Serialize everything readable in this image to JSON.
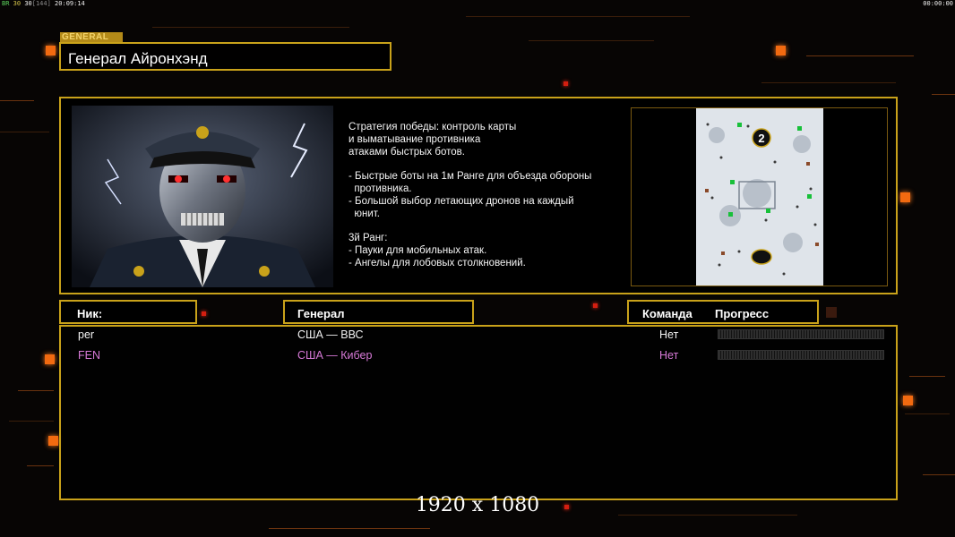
{
  "hud": {
    "left_green": "ВR",
    "left_yellow": "30",
    "left_white": "30",
    "left_gray": "[144]",
    "left_time": "20:09:14",
    "right_time": "00:00:00"
  },
  "general": {
    "category": "GENERAL",
    "name": "Генерал Айронхэнд"
  },
  "description": {
    "lines_a": [
      "Стратегия победы: контроль карты",
      "и выматывание противника",
      "атаками быстрых ботов."
    ],
    "lines_b": [
      "- Быстрые боты на 1м Ранге для объезда обороны",
      "  противника.",
      "- Большой выбор летающих дронов на каждый",
      "  юнит."
    ],
    "lines_c": [
      "3й Ранг:",
      "- Пауки для мобильных атак.",
      "- Ангелы для лобовых столкновений."
    ]
  },
  "map": {
    "player_marker": "2"
  },
  "columns": {
    "nick": "Ник:",
    "general": "Генерал",
    "team": "Команда",
    "progress": "Прогресс"
  },
  "players": [
    {
      "nick": "per",
      "general": "США — ВВС",
      "team": "Нет",
      "color": "#f2f2f2"
    },
    {
      "nick": "FEN",
      "general": "США — Кибер",
      "team": "Нет",
      "color": "#d87ad8"
    }
  ],
  "footer": {
    "resolution": "1920 x 1080"
  },
  "colors": {
    "frame": "#c9a21a",
    "accent": "#f26a10",
    "player2": "#d87ad8"
  }
}
